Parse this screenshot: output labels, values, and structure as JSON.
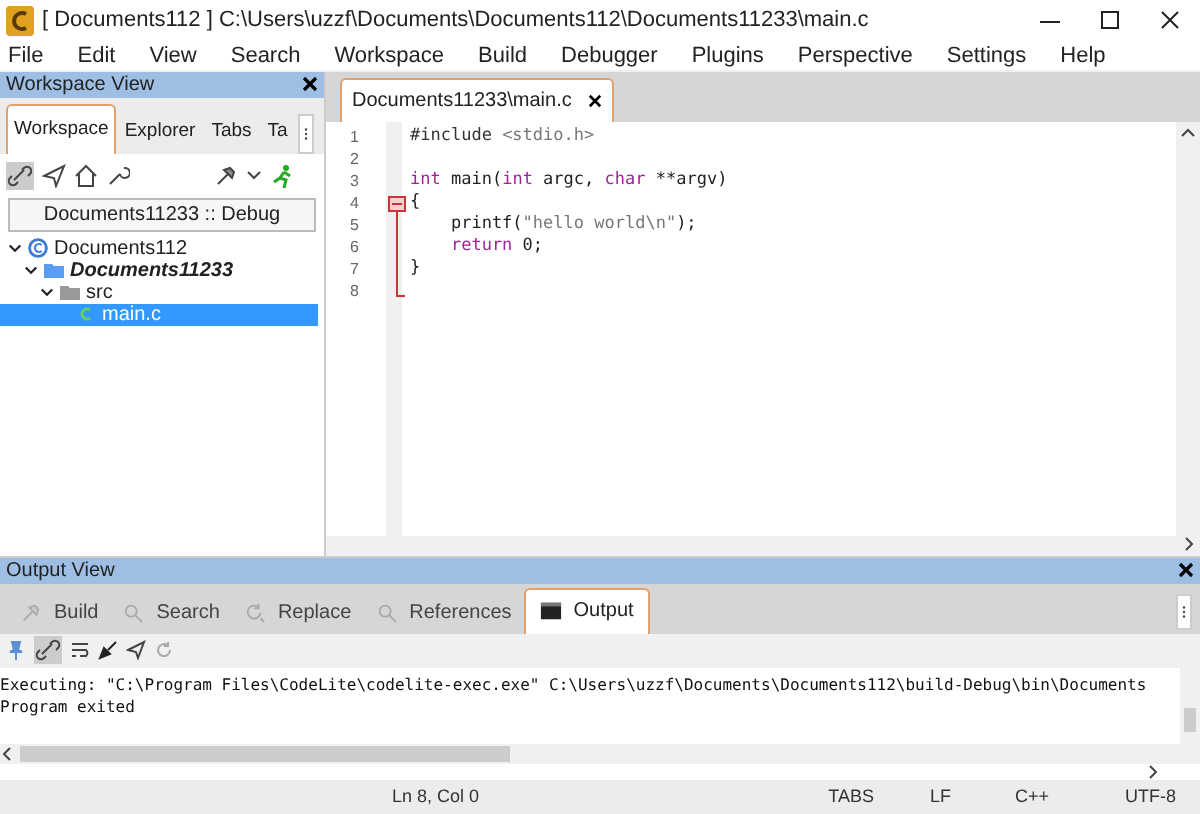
{
  "window": {
    "title": "[ Documents112 ] C:\\Users\\uzzf\\Documents\\Documents112\\Documents11233\\main.c"
  },
  "menu": [
    "File",
    "Edit",
    "View",
    "Search",
    "Workspace",
    "Build",
    "Debugger",
    "Plugins",
    "Perspective",
    "Settings",
    "Help"
  ],
  "workspace_view": {
    "title": "Workspace View",
    "tabs": [
      {
        "label": "Workspace",
        "selected": true
      },
      {
        "label": "Explorer",
        "selected": false
      },
      {
        "label": "Tabs",
        "selected": false
      },
      {
        "label": "Ta",
        "selected": false
      }
    ],
    "configuration": "Documents11233 :: Debug",
    "tree": [
      {
        "label": "Documents112",
        "kind": "workspace",
        "expanded": true,
        "selected": false,
        "children": [
          {
            "label": "Documents11233",
            "kind": "project",
            "expanded": true,
            "selected": false,
            "children": [
              {
                "label": "src",
                "kind": "folder",
                "expanded": true,
                "selected": false,
                "children": [
                  {
                    "label": "main.c",
                    "kind": "file",
                    "selected": true
                  }
                ]
              }
            ]
          }
        ]
      }
    ]
  },
  "editor": {
    "tabs": [
      {
        "label": "Documents11233\\main.c",
        "selected": true
      }
    ],
    "lines": [
      {
        "number": "1",
        "segments": [
          {
            "text": "#include ",
            "kind": "pre"
          },
          {
            "text": "<stdio.h>",
            "kind": "str"
          }
        ]
      },
      {
        "number": "2"
      },
      {
        "number": "3",
        "segments": [
          {
            "text": "int",
            "kind": "kw"
          },
          {
            "text": " main(",
            "kind": "plain"
          },
          {
            "text": "int",
            "kind": "kw"
          },
          {
            "text": " argc, ",
            "kind": "plain"
          },
          {
            "text": "char",
            "kind": "kw"
          },
          {
            "text": " **argv)",
            "kind": "plain"
          }
        ]
      },
      {
        "number": "4",
        "fold": true,
        "segments": [
          {
            "text": "{",
            "kind": "plain"
          }
        ]
      },
      {
        "number": "5",
        "segments": [
          {
            "text": "    printf(",
            "kind": "plain"
          },
          {
            "text": "\"hello world\\n\"",
            "kind": "str"
          },
          {
            "text": ");",
            "kind": "plain"
          }
        ]
      },
      {
        "number": "6",
        "segments": [
          {
            "text": "    return",
            "kind": "kw"
          },
          {
            "text": " 0;",
            "kind": "plain"
          }
        ]
      },
      {
        "number": "7",
        "segments": [
          {
            "text": "}",
            "kind": "plain"
          }
        ]
      },
      {
        "number": "8"
      }
    ]
  },
  "output_view": {
    "title": "Output View",
    "tabs": [
      {
        "label": "Build",
        "kind": "build",
        "selected": false
      },
      {
        "label": "Search",
        "kind": "search",
        "selected": false
      },
      {
        "label": "Replace",
        "kind": "replace",
        "selected": false
      },
      {
        "label": "References",
        "kind": "references",
        "selected": false
      },
      {
        "label": "Output",
        "kind": "output",
        "selected": true
      }
    ],
    "lines": [
      "Executing: \"C:\\Program Files\\CodeLite\\codelite-exec.exe\" C:\\Users\\uzzf\\Documents\\Documents112\\build-Debug\\bin\\Documents",
      "Program exited"
    ]
  },
  "status_bar": {
    "position": "Ln 8, Col 0",
    "indent": "TABS",
    "eol": "LF",
    "language": "C++",
    "encoding": "UTF-8"
  }
}
